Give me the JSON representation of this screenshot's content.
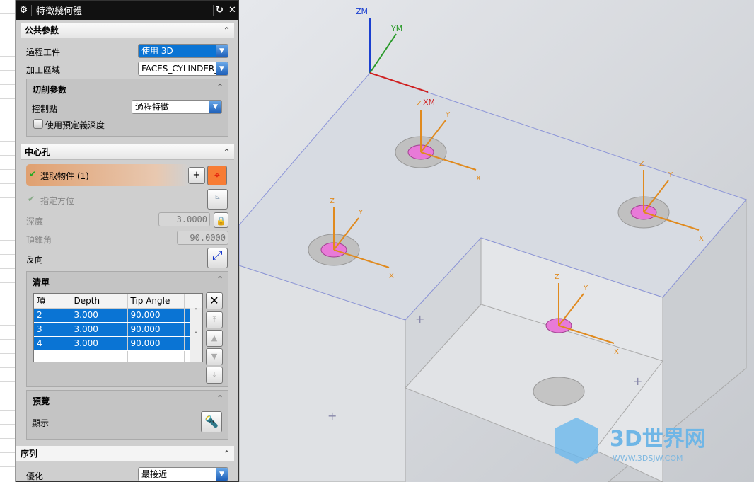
{
  "dialog": {
    "title": "特徵幾何體",
    "icons": {
      "settings": "gear-icon",
      "reset": "reset-icon",
      "close": "close-icon"
    }
  },
  "common": {
    "header": "公共參數",
    "process_workpiece_label": "過程工件",
    "process_workpiece_value": "使用 3D",
    "machining_area_label": "加工區域",
    "machining_area_value": "FACES_CYLINDER_",
    "cut_params": {
      "header": "切削參數",
      "control_point_label": "控制點",
      "control_point_value": "過程特徵",
      "use_predefined_depth_label": "使用預定義深度",
      "use_predefined_depth_checked": false
    }
  },
  "center_hole": {
    "header": "中心孔",
    "select_object_label": "選取物件 (1)",
    "specify_orientation_label": "指定方位",
    "depth_label": "深度",
    "depth_value": "3.0000",
    "tip_angle_label": "頂錐角",
    "tip_angle_value": "90.0000",
    "reverse_label": "反向",
    "list": {
      "header": "清單",
      "columns": [
        "項",
        "Depth",
        "Tip Angle"
      ],
      "rows": [
        [
          "2",
          "3.000",
          "90.000"
        ],
        [
          "3",
          "3.000",
          "90.000"
        ],
        [
          "4",
          "3.000",
          "90.000"
        ]
      ]
    }
  },
  "preview": {
    "header": "預覽",
    "show_label": "顯示"
  },
  "sequence": {
    "header": "序列",
    "optimize_label": "優化",
    "optimize_value": "最接近"
  },
  "viewport": {
    "wcs_labels": {
      "z": "ZM",
      "y": "YM",
      "x": "XM"
    },
    "axis_labels": {
      "z": "Z",
      "y": "Y",
      "x": "X"
    }
  },
  "watermark": {
    "brand": "3D世界网",
    "url": "WWW.3DSJW.COM"
  },
  "colors": {
    "accent": "#0a74d4",
    "selection": "#e8a070",
    "hole": "#e87ad8",
    "axis": "#e08a1e"
  }
}
